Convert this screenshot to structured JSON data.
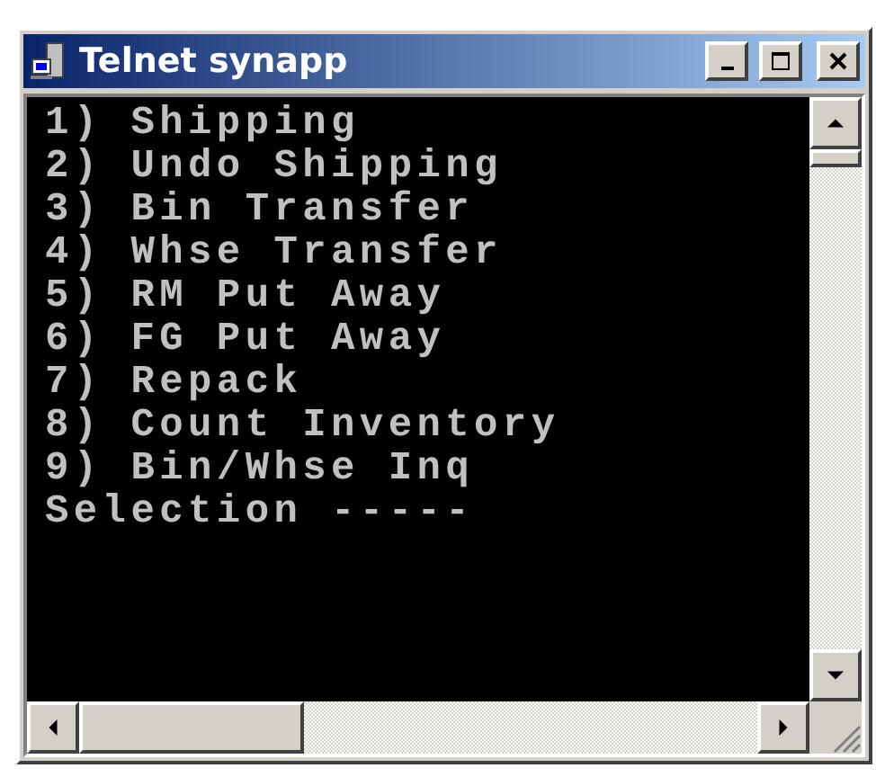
{
  "window": {
    "title": "Telnet synapp"
  },
  "terminal": {
    "lines": [
      "1) Shipping",
      "2) Undo Shipping",
      "3) Bin Transfer",
      "4) Whse Transfer",
      "5) RM Put Away",
      "6) FG Put Away",
      "7) Repack",
      "8) Count Inventory",
      "9) Bin/Whse Inq",
      "Selection -----"
    ]
  }
}
